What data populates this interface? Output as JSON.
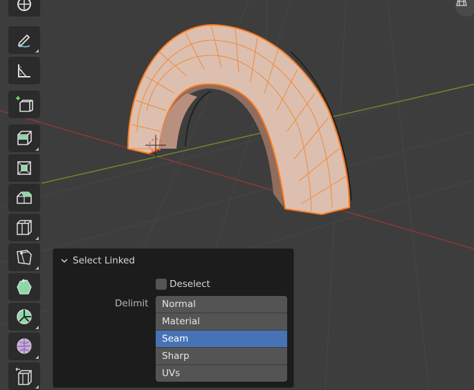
{
  "panel": {
    "title": "Select Linked",
    "deselect_label": "Deselect",
    "deselect_checked": false,
    "delimit_label": "Delimit",
    "delimit_options": [
      "Normal",
      "Material",
      "Seam",
      "Sharp",
      "UVs"
    ],
    "delimit_selected": "Seam"
  },
  "toolbar": {
    "tools": [
      {
        "icon": "transform-icon"
      },
      {
        "icon": "annotate-icon"
      },
      {
        "icon": "measure-icon"
      },
      {
        "icon": "add-cube-icon"
      },
      {
        "icon": "extrude-icon"
      },
      {
        "icon": "inset-icon"
      },
      {
        "icon": "bevel-icon"
      },
      {
        "icon": "loop-cut-icon"
      },
      {
        "icon": "knife-icon"
      },
      {
        "icon": "poly-build-icon"
      },
      {
        "icon": "spin-icon"
      },
      {
        "icon": "smooth-icon"
      },
      {
        "icon": "edge-slide-icon"
      }
    ]
  },
  "colors": {
    "viewport_bg": "#3d3d3d",
    "x_axis": "#8a3a3a",
    "y_axis": "#6a8a2a",
    "selection": "#ff8a2a",
    "mesh_face": "#d9b3a0",
    "panel_bg": "#1c1c1c",
    "selected_option": "#4772b3"
  }
}
